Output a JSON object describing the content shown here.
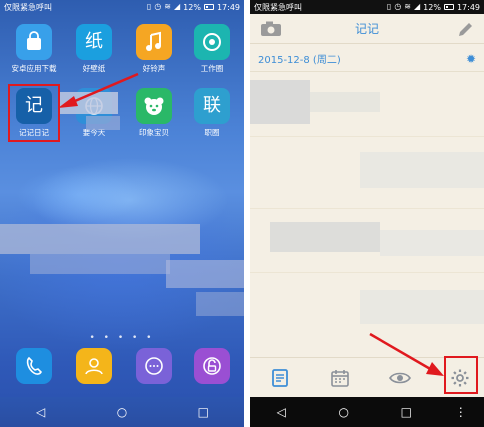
{
  "left_screen": {
    "status_bar": {
      "carrier": "仅限紧急呼叫",
      "battery": "12%",
      "time": "17:49"
    },
    "apps_row1": [
      {
        "label": "安卓应用下载",
        "icon": "shopping-bag-icon",
        "color": "#38a0ea"
      },
      {
        "label": "好壁纸",
        "icon": "wallpaper-paper-icon",
        "color": "#1b9fdf",
        "glyph": "纸"
      },
      {
        "label": "好铃声",
        "icon": "music-note-icon",
        "color": "#f5a623"
      },
      {
        "label": "工作圈",
        "icon": "work-circle-icon",
        "color": "#1cb5b0"
      }
    ],
    "apps_row2": [
      {
        "label": "记记日记",
        "icon": "diary-app-icon",
        "color": "#1660a8",
        "glyph": "记"
      },
      {
        "label": "要今天",
        "icon": "globe-icon",
        "color": "#2f8fd8"
      },
      {
        "label": "印象宝贝",
        "icon": "bear-icon",
        "color": "#2ab868"
      },
      {
        "label": "职圈",
        "icon": "job-circle-icon",
        "color": "#2e9fcf",
        "glyph": "联"
      }
    ],
    "dock": [
      {
        "icon": "phone-icon",
        "color": "#1e8ee0"
      },
      {
        "icon": "contacts-icon",
        "color": "#f4b51a"
      },
      {
        "icon": "messages-icon",
        "color": "#7a62d8"
      },
      {
        "icon": "unlock-icon",
        "color": "#9a4fd3"
      }
    ],
    "page_dots": "• • • • •"
  },
  "right_screen": {
    "status_bar": {
      "carrier": "仅限紧急呼叫",
      "battery": "12%",
      "time": "17:49"
    },
    "header_title": "记记",
    "date_label": "2015-12-8 (周二)",
    "toolbar": [
      "notes-list-icon",
      "calendar-icon",
      "eye-icon",
      "gear-icon"
    ]
  },
  "colors": {
    "accent": "#3e8ed6",
    "highlight_red": "#e0191e",
    "paper": "#f4efe4"
  }
}
